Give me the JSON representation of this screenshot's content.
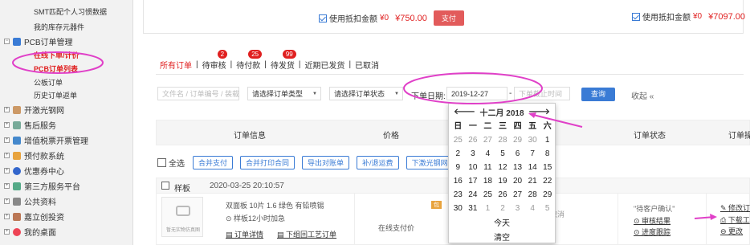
{
  "sidebar": {
    "top_items": [
      "SMT匹配个人习惯数据",
      "我的库存元器件"
    ],
    "pcb_group": "PCB订单管理",
    "pcb_subs": [
      "在线下单/计价",
      "PCB订单列表",
      "公板订单",
      "历史订单返单"
    ],
    "groups": [
      "开激光钢网",
      "售后服务",
      "增值税票开票管理",
      "预付款系统",
      "优惠券中心",
      "第三方服务平台",
      "公共资料",
      "嘉立创投资",
      "我的桌面"
    ]
  },
  "topbar": {
    "left": {
      "label": "使用抵扣金额",
      "amount": "¥0",
      "total": "¥750.00",
      "pay": "支付"
    },
    "right": {
      "label": "使用抵扣金额",
      "amount": "¥0",
      "total": "¥7097.00"
    }
  },
  "tabs": [
    {
      "label": "所有订单",
      "badge": ""
    },
    {
      "label": "待审核",
      "badge": "2"
    },
    {
      "label": "待付款",
      "badge": "25"
    },
    {
      "label": "待发货",
      "badge": "99"
    },
    {
      "label": "近期已发货",
      "badge": ""
    },
    {
      "label": "已取消",
      "badge": ""
    }
  ],
  "filters": {
    "search_placeholder": "文件名 / 订单编号 / 装载",
    "order_type": "请选择订单类型",
    "order_status": "请选择订单状态",
    "date_label": "下单日期:",
    "date_from": "2019-12-27",
    "date_sep": "-",
    "date_to_placeholder": "下单截止时间",
    "search_btn": "查询",
    "collapse": "收起 «"
  },
  "table_header": [
    "订单信息",
    "价格",
    "订单状态",
    "订单操"
  ],
  "actions": {
    "select_all": "全选",
    "buttons": [
      "合并支付",
      "合并打印合同",
      "导出对账单",
      "补/退运费",
      "下激光钢网"
    ]
  },
  "order": {
    "type": "样板",
    "time": "2020-03-25 20:10:57",
    "image_text": "暂无实物仿真图",
    "specs": "双面板  10片  1.6  绿色  有铅喷锡",
    "urgent": "样板12小时加急",
    "link1": "订单详情",
    "link2": "下组回工艺订单",
    "pay_method": "在线支付价",
    "status": "\"待客户确认\"",
    "status_link1": "审核结果",
    "status_link2": "进度跟踪",
    "op1": "修改订",
    "op2": "下载工",
    "op3": "更改",
    "cancel_text": "取消"
  },
  "calendar": {
    "prev": "🡐",
    "title": "十二月 2018",
    "next": "🡒",
    "weekdays": [
      "日",
      "一",
      "二",
      "三",
      "四",
      "五",
      "六"
    ],
    "weeks": [
      [
        "25",
        "26",
        "27",
        "28",
        "29",
        "30",
        "1"
      ],
      [
        "2",
        "3",
        "4",
        "5",
        "6",
        "7",
        "8"
      ],
      [
        "9",
        "10",
        "11",
        "12",
        "13",
        "14",
        "15"
      ],
      [
        "16",
        "17",
        "18",
        "19",
        "20",
        "21",
        "22"
      ],
      [
        "23",
        "24",
        "25",
        "26",
        "27",
        "28",
        "29"
      ],
      [
        "30",
        "31",
        "1",
        "2",
        "3",
        "4",
        "5"
      ]
    ],
    "today": "今天",
    "clear": "清空"
  },
  "colors": {
    "accent": "#3a7bd5",
    "red": "#e02020",
    "annotation": "#e040c8"
  }
}
